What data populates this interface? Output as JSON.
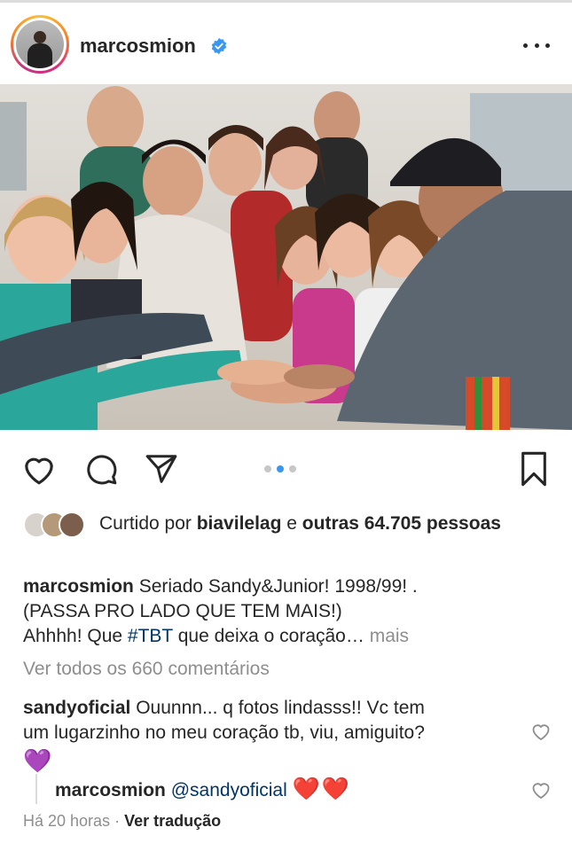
{
  "post": {
    "author": "marcosmion",
    "verified": true,
    "photo_alt": "",
    "carousel": {
      "count": 3,
      "active_index": 1
    },
    "likes": {
      "prefix": "Curtido por ",
      "liker": "biavilelag",
      "joiner": " e ",
      "others": "outras 64.705 pessoas"
    },
    "caption": {
      "author": "marcosmion",
      "line1": " Seriado Sandy&Junior! 1998/99! .",
      "line2": "(PASSA PRO LADO QUE TEM MAIS!)",
      "line3_before": "Ahhhh! Que ",
      "hashtag": "#TBT",
      "line3_after": " que deixa o coração… ",
      "more": "mais"
    },
    "view_all_comments": "Ver todos os 660 comentários",
    "comments": [
      {
        "author": "sandyoficial",
        "line1": " Ouunnn... q fotos lindasss!! Vc tem",
        "line2": "um lugarzinho no meu coração tb, viu, amiguito?",
        "emoji": "💜"
      },
      {
        "author": "marcosmion",
        "mention": "@sandyoficial",
        "emoji": "❤️❤️"
      }
    ],
    "time": "Há 20 horas",
    "separator": " · ",
    "translate": "Ver tradução"
  },
  "colors": {
    "text": "#262626",
    "muted": "#8e8e8e",
    "link": "#003569",
    "accent": "#3897f0",
    "verified": "#3897f0"
  },
  "icons": {
    "like": "heart-outline-icon",
    "comment": "speech-bubble-icon",
    "share": "paper-plane-icon",
    "save": "bookmark-icon",
    "more": "ellipsis-icon",
    "verified": "verified-badge-icon",
    "comment_like": "small-heart-icon"
  }
}
